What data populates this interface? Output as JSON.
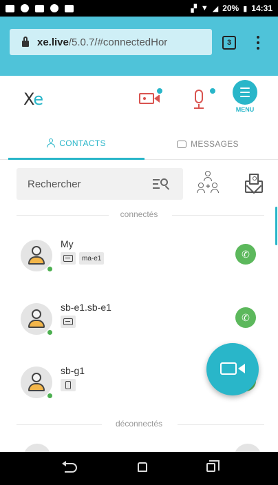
{
  "status_bar": {
    "battery": "20%",
    "time": "14:31"
  },
  "browser": {
    "url_host": "xe.live",
    "url_path": "/5.0.7/#connectedHor",
    "tab_count": "3"
  },
  "app": {
    "logo_x": "X",
    "logo_e": "e",
    "menu_label": "MENU"
  },
  "tabs": [
    {
      "label": "CONTACTS",
      "active": true
    },
    {
      "label": "MESSAGES",
      "active": false
    }
  ],
  "search": {
    "placeholder": "Rechercher"
  },
  "sections": {
    "connected": "connectés",
    "disconnected": "déconnectés"
  },
  "contacts": [
    {
      "name": "My",
      "tags": [
        "device",
        "ma-e1"
      ],
      "status": "online"
    },
    {
      "name": "sb-e1.sb-e1",
      "tags": [
        "device"
      ],
      "status": "online"
    },
    {
      "name": "sb-g1",
      "tags": [
        "phone"
      ],
      "status": "online"
    }
  ],
  "colors": {
    "accent": "#29b6c9",
    "online": "#4caf50",
    "call": "#5cb85c",
    "alert": "#d9534f"
  }
}
